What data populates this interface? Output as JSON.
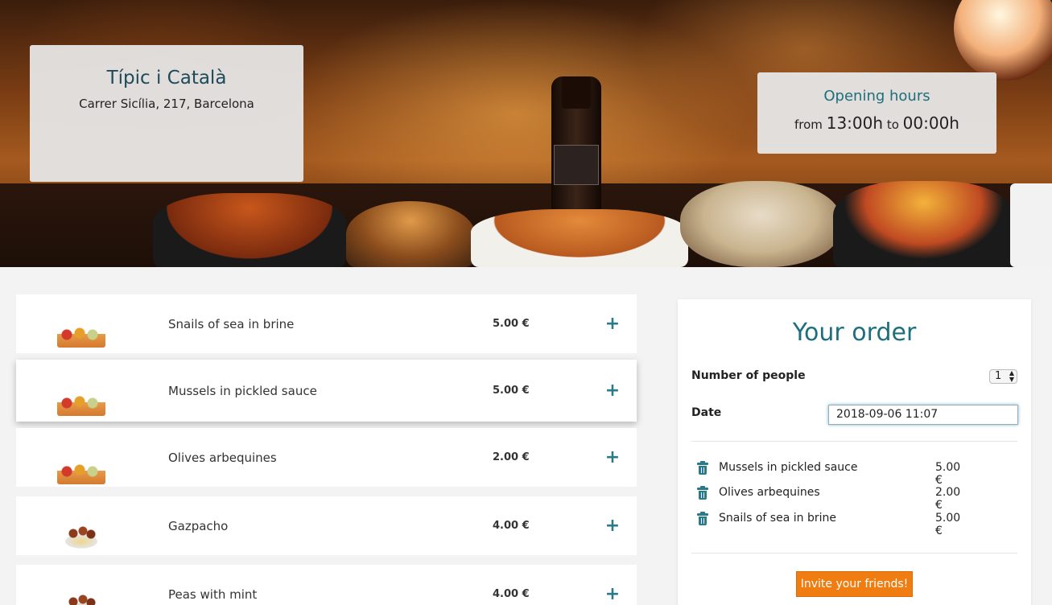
{
  "restaurant": {
    "name": "Típic i Català",
    "address": "Carrer Sicília, 217, Barcelona"
  },
  "hours": {
    "title": "Opening hours",
    "from_label": "from",
    "open": "13:00h",
    "to_label": "to",
    "close": "00:00h"
  },
  "menu": {
    "items": [
      {
        "name": "Snails of sea in brine",
        "price": "5.00 €",
        "add": "+",
        "image": "tapas-image"
      },
      {
        "name": "Mussels in pickled sauce",
        "price": "5.00 €",
        "add": "+",
        "image": "tapas-image"
      },
      {
        "name": "Olives arbequines",
        "price": "2.00 €",
        "add": "+",
        "image": "tapas-image"
      },
      {
        "name": "Gazpacho",
        "price": "4.00 €",
        "add": "+",
        "image": "pasta-image"
      },
      {
        "name": "Peas with mint",
        "price": "4.00 €",
        "add": "+",
        "image": "pasta-image"
      }
    ]
  },
  "order": {
    "title": "Your order",
    "people_label": "Number of people",
    "people_value": "1",
    "date_label": "Date",
    "date_value": "2018-09-06 11:07",
    "lines": [
      {
        "name": "Mussels in pickled sauce",
        "price": "5.00 €"
      },
      {
        "name": "Olives arbequines",
        "price": "2.00 €"
      },
      {
        "name": "Snails of sea in brine",
        "price": "5.00 €"
      }
    ],
    "invite_label": "Invite your friends!"
  },
  "colors": {
    "accent": "#1e6f7d",
    "button": "#f07d12"
  }
}
